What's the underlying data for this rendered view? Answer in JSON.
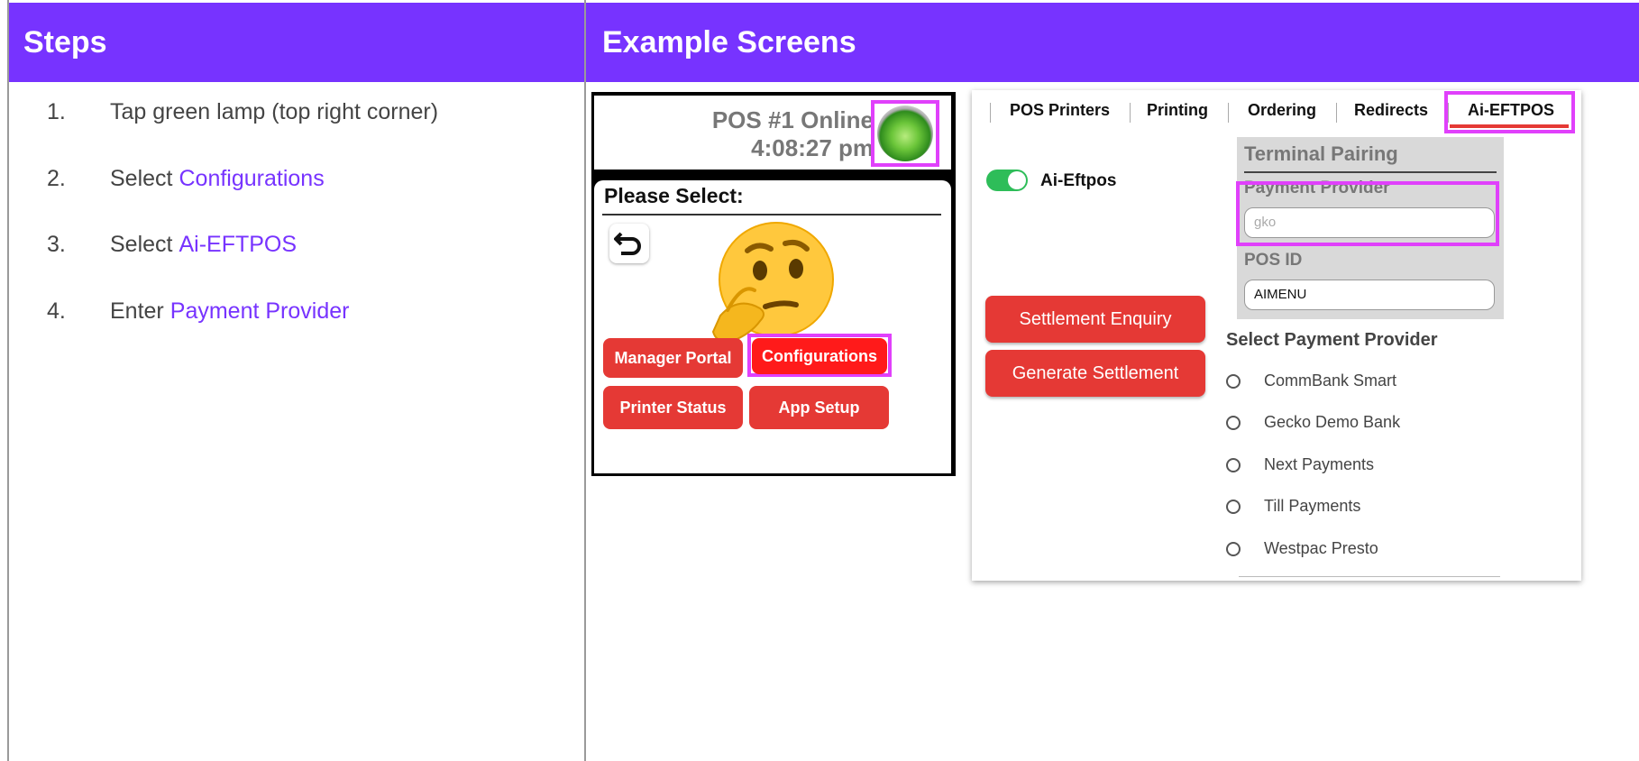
{
  "headers": {
    "steps": "Steps",
    "examples": "Example Screens"
  },
  "steps": [
    {
      "num": "1.",
      "text": "Tap green lamp (top right corner)",
      "highlight": ""
    },
    {
      "num": "2.",
      "text": "Select",
      "highlight": "Configurations"
    },
    {
      "num": "3.",
      "text": "Select",
      "highlight": "Ai-EFTPOS"
    },
    {
      "num": "4.",
      "text": "Enter",
      "highlight": "Payment Provider"
    }
  ],
  "screen1": {
    "status_line1": "POS #1 Online",
    "status_line2": "4:08:27 pm",
    "title": "Please Select:",
    "buttons": {
      "manager_portal": "Manager Portal",
      "configurations": "Configurations",
      "printer_status": "Printer Status",
      "app_setup": "App Setup"
    }
  },
  "screen2": {
    "tabs": [
      "POS Printers",
      "Printing",
      "Ordering",
      "Redirects",
      "Ai-EFTPOS"
    ],
    "toggle_label": "Ai-Eftpos",
    "terminal_pairing": "Terminal Pairing",
    "payment_provider_label": "Payment Provider",
    "payment_provider_value": "gko",
    "pos_id_label": "POS ID",
    "pos_id_value": "AIMENU",
    "settlement_enquiry": "Settlement Enquiry",
    "generate_settlement": "Generate Settlement",
    "select_provider_title": "Select Payment Provider",
    "providers": [
      "CommBank Smart",
      "Gecko Demo Bank",
      "Next Payments",
      "Till Payments",
      "Westpac Presto"
    ]
  },
  "colors": {
    "header": "#7733ff",
    "highlight": "#7733ff",
    "button_red": "#e53935",
    "frame_magenta": "#e040fb",
    "toggle_green": "#2ebd59"
  }
}
